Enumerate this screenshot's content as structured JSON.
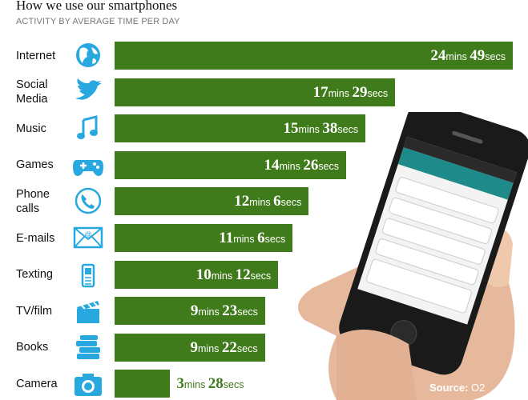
{
  "title": "How we use our smartphones",
  "subtitle": "ACTIVITY BY AVERAGE TIME PER DAY",
  "source_label": "Source:",
  "source_value": "O2",
  "colors": {
    "bar": "#3f7a1b",
    "icon": "#29a8e0",
    "label_inside": "#ffffff"
  },
  "chart_data": {
    "type": "bar",
    "orientation": "horizontal",
    "title": "How we use our smartphones",
    "subtitle": "ACTIVITY BY AVERAGE TIME PER DAY",
    "unit_labels": {
      "minutes": "mins",
      "seconds": "secs"
    },
    "categories": [
      "Internet",
      "Social Media",
      "Music",
      "Games",
      "Phone calls",
      "E-mails",
      "Texting",
      "TV/film",
      "Books",
      "Camera"
    ],
    "category_lines": [
      [
        "Internet"
      ],
      [
        "Social",
        "Media"
      ],
      [
        "Music"
      ],
      [
        "Games"
      ],
      [
        "Phone",
        "calls"
      ],
      [
        "E-mails"
      ],
      [
        "Texting"
      ],
      [
        "TV/film"
      ],
      [
        "Books"
      ],
      [
        "Camera"
      ]
    ],
    "icons": [
      "globe-icon",
      "twitter-bird-icon",
      "music-note-icon",
      "gamepad-icon",
      "phone-icon",
      "envelope-icon",
      "mobile-phone-icon",
      "clapperboard-icon",
      "books-icon",
      "camera-icon"
    ],
    "values": [
      {
        "mins": 24,
        "secs": 49
      },
      {
        "mins": 17,
        "secs": 29
      },
      {
        "mins": 15,
        "secs": 38
      },
      {
        "mins": 14,
        "secs": 26
      },
      {
        "mins": 12,
        "secs": 6
      },
      {
        "mins": 11,
        "secs": 6
      },
      {
        "mins": 10,
        "secs": 12
      },
      {
        "mins": 9,
        "secs": 23
      },
      {
        "mins": 9,
        "secs": 22
      },
      {
        "mins": 3,
        "secs": 28
      }
    ]
  }
}
